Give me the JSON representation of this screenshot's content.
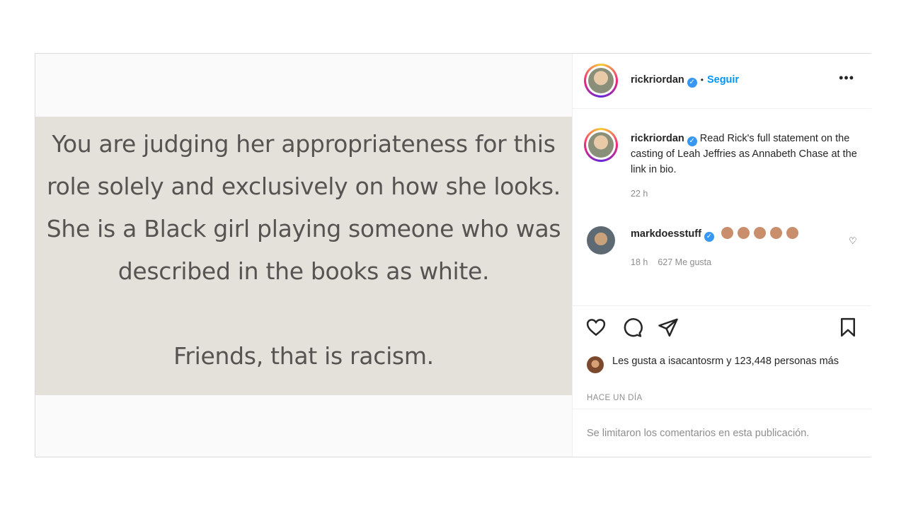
{
  "post": {
    "quote_lines": [
      "You are judging her appropriateness for this",
      "role solely and exclusively on how she looks.",
      "She is a Black girl playing someone who was",
      "described in the books as white."
    ],
    "quote_final": "Friends, that is racism.",
    "header": {
      "username": "rickriordan",
      "separator": "•",
      "follow_label": "Seguir",
      "more_label": "•••"
    },
    "caption": {
      "username": "rickriordan",
      "text": "Read Rick's full statement on the casting of Leah Jeffries as Annabeth Chase at the link in bio.",
      "time": "22 h"
    },
    "comment": {
      "username": "markdoesstuff",
      "emoji_count": 5,
      "time": "18 h",
      "likes": "627 Me gusta"
    },
    "likes_text": "Les gusta a isacantosrm y 123,448 personas más",
    "posted_ago": "HACE UN DÍA",
    "comments_limited": "Se limitaron los comentarios en esta publicación."
  },
  "colors": {
    "accent": "#0095f6",
    "verified": "#3897f0",
    "quote_bg": "#e4e1da",
    "quote_text": "#555452",
    "muted": "#8e8e8e"
  },
  "icons": [
    "verified-badge-icon",
    "more-options-icon",
    "like-heart-icon",
    "comment-icon",
    "share-icon",
    "save-bookmark-icon",
    "comment-like-heart-icon"
  ]
}
